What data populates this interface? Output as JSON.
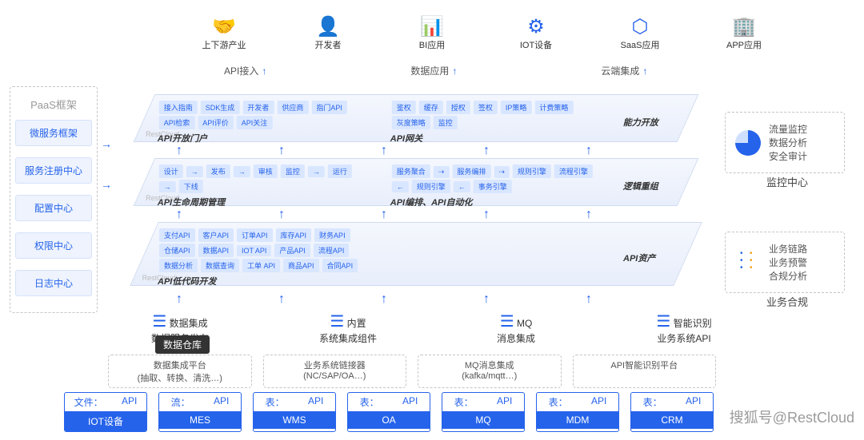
{
  "top": [
    {
      "icon": "🤝",
      "label": "上下游产业"
    },
    {
      "icon": "👤",
      "label": "开发者"
    },
    {
      "icon": "📊",
      "label": "BI应用"
    },
    {
      "icon": "⚙",
      "label": "IOT设备"
    },
    {
      "icon": "⬡",
      "label": "SaaS应用"
    },
    {
      "icon": "🏢",
      "label": "APP应用"
    }
  ],
  "subLabels": [
    "API接入",
    "数据应用",
    "云端集成"
  ],
  "paas": {
    "title": "PaaS框架",
    "items": [
      "微服务框架",
      "服务注册中心",
      "配置中心",
      "权限中心",
      "日志中心"
    ]
  },
  "layers": {
    "l1": {
      "left": {
        "tags": [
          "接入指南",
          "SDK生成",
          "开发者",
          "供应商",
          "指门API",
          "API检索",
          "API评价",
          "API关注"
        ],
        "title": "API开放门户"
      },
      "right": {
        "tags": [
          "鉴权",
          "缓存",
          "授权",
          "签权",
          "IP策略",
          "计费策略",
          "灰度策略",
          "监控"
        ],
        "title": "API网关",
        "side": "能力开放"
      }
    },
    "l2": {
      "left": {
        "tags": [
          "设计",
          "→",
          "发布",
          "→",
          "审核",
          "监控",
          "→",
          "运行",
          "→",
          "下线"
        ],
        "title": "API生命周期管理"
      },
      "right": {
        "tags": [
          "服务聚合",
          "⇢",
          "服务编排",
          "⇢",
          "规则引擎",
          "流程引擎",
          "←",
          "规则引擎",
          "←",
          "事务引擎"
        ],
        "title": "API编排、API自动化",
        "side": "逻辑重组"
      }
    },
    "l3": {
      "left": {
        "tags": [
          "支付API",
          "客户API",
          "订单API",
          "库存API",
          "财务API",
          "仓储API",
          "数据API",
          "IOT API",
          "产品API",
          "流程API",
          "数据分析",
          "数据查询",
          "工单 API",
          "商品API",
          "合同API"
        ],
        "title": "API低代码开发"
      },
      "right": {
        "side": "API资产"
      }
    }
  },
  "services": [
    {
      "t1": "数据集成",
      "t2": "数据服务发布"
    },
    {
      "t1": "内置",
      "t2": "系统集成组件"
    },
    {
      "t1": "MQ",
      "t2": "消息集成"
    },
    {
      "t1": "智能识别",
      "t2": "业务系统API"
    }
  ],
  "dw": "数据仓库",
  "platforms": [
    "数据集成平台\n(抽取、转换、清洗…)",
    "业务系统链接器\n(NC/SAP/OA…)",
    "MQ消息集成\n(kafka/mqtt…)",
    "API智能识别平台"
  ],
  "sources": [
    {
      "t": "文件：",
      "a": "API",
      "b": "IOT设备"
    },
    {
      "t": "流：",
      "a": "API",
      "b": "MES"
    },
    {
      "t": "表：",
      "a": "API",
      "b": "WMS"
    },
    {
      "t": "表：",
      "a": "API",
      "b": "OA"
    },
    {
      "t": "表：",
      "a": "API",
      "b": "MQ"
    },
    {
      "t": "表：",
      "a": "API",
      "b": "MDM"
    },
    {
      "t": "表：",
      "a": "API",
      "b": "CRM"
    }
  ],
  "monitor": {
    "lines": [
      "流量监控",
      "数据分析",
      "安全审计"
    ],
    "title": "监控中心"
  },
  "biz": {
    "lines": [
      "业务链路",
      "业务预警",
      "合规分析"
    ],
    "title": "业务合规"
  },
  "watermark": "搜狐号@RestCloud"
}
